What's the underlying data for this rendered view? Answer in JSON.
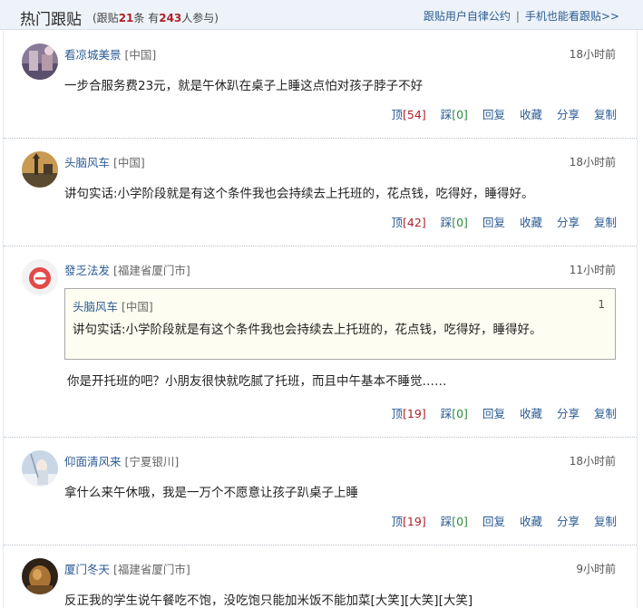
{
  "header": {
    "title": "热门跟贴",
    "stats_prefix": "(跟贴",
    "post_count": "21",
    "stats_mid": "条 有",
    "participant_count": "243",
    "stats_suffix": "人参与)",
    "link_convention": "跟贴用户自律公约",
    "link_separator": "|",
    "link_mobile": "手机也能看跟贴>>"
  },
  "actions_labels": {
    "up": "顶",
    "down": "踩",
    "reply": "回复",
    "collect": "收藏",
    "share": "分享",
    "copy": "复制"
  },
  "posts": [
    {
      "user": "看凉城美景",
      "location": "[中国]",
      "time": "18小时前",
      "content": "一步合服务费23元，就是午休趴在桌子上睡这点怕对孩子脖子不好",
      "up": "[54]",
      "down": "[0]"
    },
    {
      "user": "头脑风车",
      "location": "[中国]",
      "time": "18小时前",
      "content": "讲句实话:小学阶段就是有这个条件我也会持续去上托班的，花点钱，吃得好，睡得好。",
      "up": "[42]",
      "down": "[0]"
    },
    {
      "user": "發乏法发",
      "location": "[福建省厦门市]",
      "time": "11小时前",
      "quote": {
        "user": "头脑风车",
        "location": "[中国]",
        "floor": "1",
        "text": "讲句实话:小学阶段就是有这个条件我也会持续去上托班的，花点钱，吃得好，睡得好。"
      },
      "content": "你是开托班的吧？小朋友很快就吃腻了托班，而且中午基本不睡觉……",
      "up": "[19]",
      "down": "[0]"
    },
    {
      "user": "仰面清风来",
      "location": "[宁夏银川]",
      "time": "18小时前",
      "content": "拿什么来午休哦，我是一万个不愿意让孩子趴桌子上睡",
      "up": "[19]",
      "down": "[0]"
    },
    {
      "user": "厦门冬天",
      "location": "[福建省厦门市]",
      "time": "9小时前",
      "content": "反正我的学生说午餐吃不饱，没吃饱只能加米饭不能加菜[大笑][大笑][大笑]"
    }
  ]
}
